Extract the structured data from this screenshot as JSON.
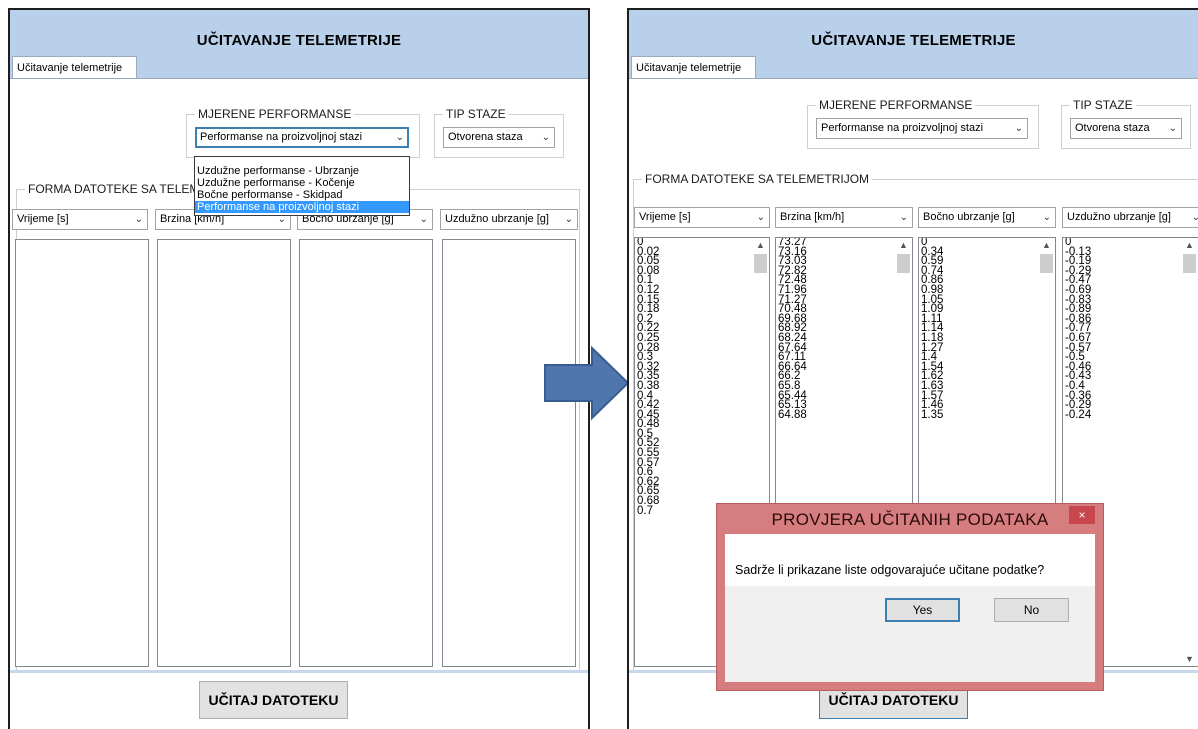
{
  "left": {
    "title": "UČITAVANJE TELEMETRIJE",
    "tab": "Učitavanje telemetrije",
    "mjerene_label": "MJERENE PERFORMANSE",
    "mjerene_value": "Performanse na proizvoljnoj stazi",
    "tip_label": "TIP STAZE",
    "tip_value": "Otvorena staza",
    "forma_label": "FORMA DATOTEKE SA TELEMETRIJOM",
    "dropdown_options": [
      "Uzdužne performanse - Ubrzanje",
      "Uzdužne performanse - Kočenje",
      "Bočne performanse - Skidpad",
      "Performanse na proizvoljnoj stazi"
    ],
    "columns": [
      "Vrijeme [s]",
      "Brzina [km/h]",
      "Bočno ubrzanje [g]",
      "Uzdužno ubrzanje [g]"
    ],
    "button": "UČITAJ DATOTEKU"
  },
  "right": {
    "title": "UČITAVANJE TELEMETRIJE",
    "tab": "Učitavanje telemetrije",
    "mjerene_label": "MJERENE PERFORMANSE",
    "mjerene_value": "Performanse na proizvoljnoj stazi",
    "tip_label": "TIP STAZE",
    "tip_value": "Otvorena staza",
    "forma_label": "FORMA DATOTEKE SA TELEMETRIJOM",
    "columns": [
      "Vrijeme [s]",
      "Brzina [km/h]",
      "Bočno ubrzanje [g]",
      "Uzdužno ubrzanje [g]"
    ],
    "lists": {
      "time": [
        "0",
        "0.02",
        "0.05",
        "0.08",
        "0.1",
        "0.12",
        "0.15",
        "0.18",
        "0.2",
        "0.22",
        "0.25",
        "0.28",
        "0.3",
        "0.32",
        "0.35",
        "0.38",
        "0.4",
        "0.42",
        "0.45",
        "0.48",
        "0.5",
        "0.52",
        "0.55",
        "0.57",
        "0.6",
        "0.62",
        "0.65",
        "0.68",
        "0.7"
      ],
      "speed": [
        "73.27",
        "73.16",
        "73.03",
        "72.82",
        "72.48",
        "71.96",
        "71.27",
        "70.48",
        "69.68",
        "68.92",
        "68.24",
        "67.64",
        "67.11",
        "66.64",
        "66.2",
        "65.8",
        "65.44",
        "65.13",
        "64.88"
      ],
      "lateral": [
        "0",
        "0.34",
        "0.59",
        "0.74",
        "0.86",
        "0.98",
        "1.05",
        "1.09",
        "1.11",
        "1.14",
        "1.18",
        "1.27",
        "1.4",
        "1.54",
        "1.62",
        "1.63",
        "1.57",
        "1.46",
        "1.35"
      ],
      "longitudinal": [
        "0",
        "-0.13",
        "-0.19",
        "-0.29",
        "-0.47",
        "-0.69",
        "-0.83",
        "-0.89",
        "-0.86",
        "-0.77",
        "-0.67",
        "-0.57",
        "-0.5",
        "-0.46",
        "-0.43",
        "-0.4",
        "-0.36",
        "-0.29",
        "-0.24"
      ]
    },
    "button": "UČITAJ DATOTEKU",
    "dialog": {
      "title": "PROVJERA UČITANIH PODATAKA",
      "close": "×",
      "message": "Sadrže li prikazane liste odgovarajuće učitane podatke?",
      "yes": "Yes",
      "no": "No"
    }
  },
  "icons": {
    "chevron": "chevron-down-icon",
    "arrow": "right-arrow-icon"
  },
  "colors": {
    "header": "#b8d0ea",
    "arrow": "#4f77ad",
    "selection": "#3399ff",
    "dialog_frame": "#d67d7f"
  },
  "glyphs": {
    "chev": "⌄",
    "up": "▲",
    "down": "▼"
  }
}
